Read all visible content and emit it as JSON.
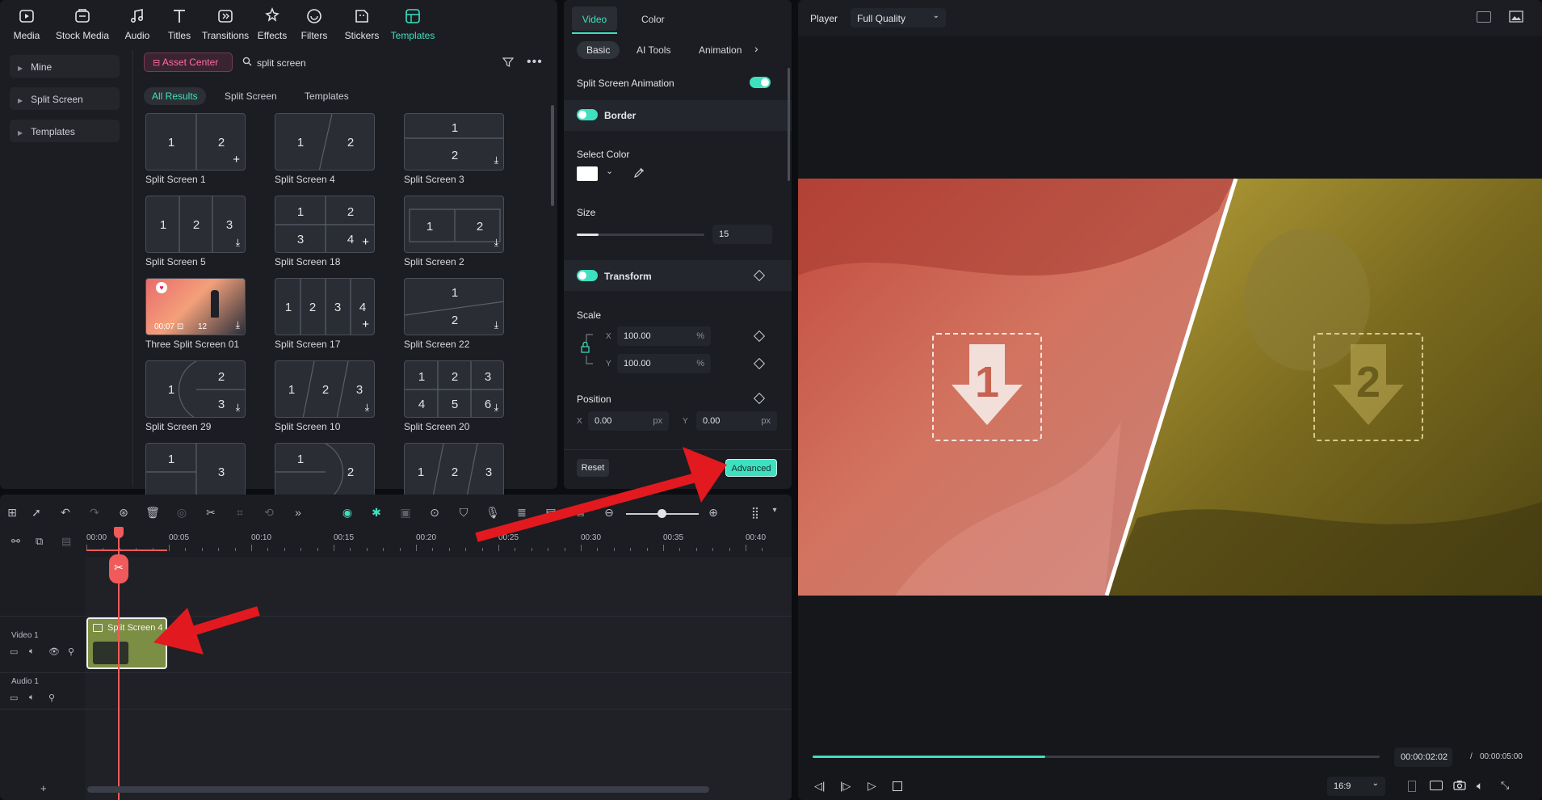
{
  "toolbar": {
    "items": [
      {
        "label": "Media",
        "icon": "media-icon"
      },
      {
        "label": "Stock Media",
        "icon": "stock-media-icon"
      },
      {
        "label": "Audio",
        "icon": "music-note-icon"
      },
      {
        "label": "Titles",
        "icon": "titles-icon"
      },
      {
        "label": "Transitions",
        "icon": "transitions-icon"
      },
      {
        "label": "Effects",
        "icon": "effects-icon"
      },
      {
        "label": "Filters",
        "icon": "filters-icon"
      },
      {
        "label": "Stickers",
        "icon": "stickers-icon"
      },
      {
        "label": "Templates",
        "icon": "templates-icon"
      }
    ],
    "active": "Templates",
    "accent": "#3fe0c0"
  },
  "sidebar": {
    "items": [
      {
        "label": "Mine"
      },
      {
        "label": "Split Screen"
      },
      {
        "label": "Templates"
      }
    ]
  },
  "search": {
    "asset_center": "Asset Center",
    "query": "split screen",
    "filters": [
      "All Results",
      "Split Screen",
      "Templates"
    ]
  },
  "templates": [
    {
      "label": "Split Screen 1",
      "digits": [
        "1",
        "2"
      ]
    },
    {
      "label": "Split Screen 4",
      "digits": [
        "1",
        "2"
      ]
    },
    {
      "label": "Split Screen 3",
      "digits": [
        "1",
        "2"
      ]
    },
    {
      "label": "Split Screen 5",
      "digits": [
        "1",
        "2",
        "3"
      ]
    },
    {
      "label": "Split Screen 18",
      "digits": [
        "1",
        "2",
        "3",
        "4"
      ]
    },
    {
      "label": "Split Screen 2",
      "digits": [
        "1",
        "2"
      ]
    },
    {
      "label": "Three Split Screen 01",
      "duration": "00:07",
      "count": "12"
    },
    {
      "label": "Split Screen 17",
      "digits": [
        "1",
        "2",
        "3",
        "4"
      ]
    },
    {
      "label": "Split Screen 22",
      "digits": [
        "1",
        "2"
      ]
    },
    {
      "label": "Split Screen 29",
      "digits": [
        "1",
        "2",
        "3"
      ]
    },
    {
      "label": "Split Screen 10",
      "digits": [
        "1",
        "2",
        "3"
      ]
    },
    {
      "label": "Split Screen 20",
      "digits": [
        "1",
        "2",
        "3",
        "4",
        "5",
        "6"
      ]
    },
    {
      "label": "",
      "digits": [
        "1",
        "3"
      ]
    },
    {
      "label": "",
      "digits": [
        "1",
        "2"
      ]
    },
    {
      "label": "",
      "digits": [
        "1",
        "2",
        "3"
      ]
    }
  ],
  "properties": {
    "tabs": [
      "Video",
      "Color"
    ],
    "subtabs": [
      "Basic",
      "AI Tools",
      "Animation"
    ],
    "split_screen_animation": "Split Screen Animation",
    "border": "Border",
    "select_color": "Select Color",
    "border_color": "#ffffff",
    "size_label": "Size",
    "size_value": "15",
    "size_fraction": 0.17,
    "transform": "Transform",
    "scale": "Scale",
    "scale_x": "100.00",
    "scale_y": "100.00",
    "percent": "%",
    "position": "Position",
    "pos_x": "0.00",
    "pos_y": "0.00",
    "px": "px",
    "x": "X",
    "y": "Y",
    "reset": "Reset",
    "advanced": "Advanced"
  },
  "player": {
    "title": "Player",
    "quality": "Full Quality",
    "current_time": "00:00:02:02",
    "separator": "/",
    "total_time": "00:00:05:00",
    "progress": 0.41,
    "aspect": "16:9",
    "slot1": "1",
    "slot2": "2"
  },
  "timeline": {
    "ticks": [
      "00:00",
      "00:05",
      "00:10",
      "00:15",
      "00:20",
      "00:25",
      "00:30",
      "00:35",
      "00:40"
    ],
    "tracks": [
      "Video 1",
      "Audio 1"
    ],
    "clip_label": "Split Screen 4",
    "add": "+"
  }
}
